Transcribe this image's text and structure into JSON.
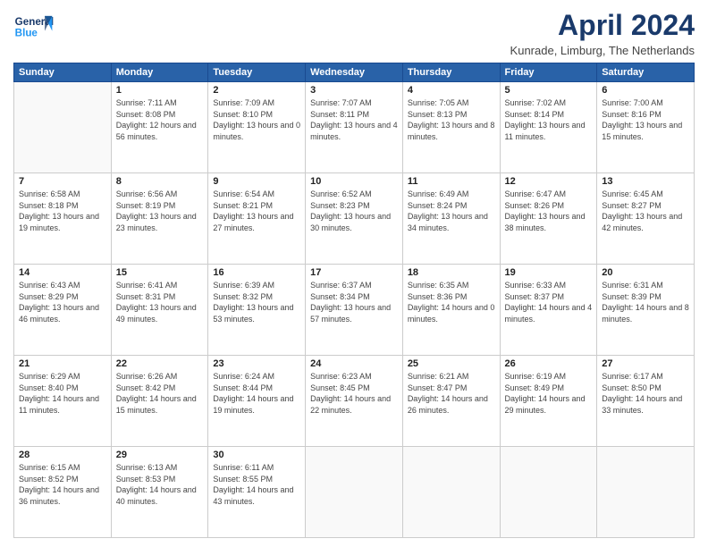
{
  "header": {
    "logo_line1": "General",
    "logo_line2": "Blue",
    "month_title": "April 2024",
    "location": "Kunrade, Limburg, The Netherlands"
  },
  "weekdays": [
    "Sunday",
    "Monday",
    "Tuesday",
    "Wednesday",
    "Thursday",
    "Friday",
    "Saturday"
  ],
  "weeks": [
    [
      {
        "day": "",
        "sunrise": "",
        "sunset": "",
        "daylight": ""
      },
      {
        "day": "1",
        "sunrise": "Sunrise: 7:11 AM",
        "sunset": "Sunset: 8:08 PM",
        "daylight": "Daylight: 12 hours and 56 minutes."
      },
      {
        "day": "2",
        "sunrise": "Sunrise: 7:09 AM",
        "sunset": "Sunset: 8:10 PM",
        "daylight": "Daylight: 13 hours and 0 minutes."
      },
      {
        "day": "3",
        "sunrise": "Sunrise: 7:07 AM",
        "sunset": "Sunset: 8:11 PM",
        "daylight": "Daylight: 13 hours and 4 minutes."
      },
      {
        "day": "4",
        "sunrise": "Sunrise: 7:05 AM",
        "sunset": "Sunset: 8:13 PM",
        "daylight": "Daylight: 13 hours and 8 minutes."
      },
      {
        "day": "5",
        "sunrise": "Sunrise: 7:02 AM",
        "sunset": "Sunset: 8:14 PM",
        "daylight": "Daylight: 13 hours and 11 minutes."
      },
      {
        "day": "6",
        "sunrise": "Sunrise: 7:00 AM",
        "sunset": "Sunset: 8:16 PM",
        "daylight": "Daylight: 13 hours and 15 minutes."
      }
    ],
    [
      {
        "day": "7",
        "sunrise": "Sunrise: 6:58 AM",
        "sunset": "Sunset: 8:18 PM",
        "daylight": "Daylight: 13 hours and 19 minutes."
      },
      {
        "day": "8",
        "sunrise": "Sunrise: 6:56 AM",
        "sunset": "Sunset: 8:19 PM",
        "daylight": "Daylight: 13 hours and 23 minutes."
      },
      {
        "day": "9",
        "sunrise": "Sunrise: 6:54 AM",
        "sunset": "Sunset: 8:21 PM",
        "daylight": "Daylight: 13 hours and 27 minutes."
      },
      {
        "day": "10",
        "sunrise": "Sunrise: 6:52 AM",
        "sunset": "Sunset: 8:23 PM",
        "daylight": "Daylight: 13 hours and 30 minutes."
      },
      {
        "day": "11",
        "sunrise": "Sunrise: 6:49 AM",
        "sunset": "Sunset: 8:24 PM",
        "daylight": "Daylight: 13 hours and 34 minutes."
      },
      {
        "day": "12",
        "sunrise": "Sunrise: 6:47 AM",
        "sunset": "Sunset: 8:26 PM",
        "daylight": "Daylight: 13 hours and 38 minutes."
      },
      {
        "day": "13",
        "sunrise": "Sunrise: 6:45 AM",
        "sunset": "Sunset: 8:27 PM",
        "daylight": "Daylight: 13 hours and 42 minutes."
      }
    ],
    [
      {
        "day": "14",
        "sunrise": "Sunrise: 6:43 AM",
        "sunset": "Sunset: 8:29 PM",
        "daylight": "Daylight: 13 hours and 46 minutes."
      },
      {
        "day": "15",
        "sunrise": "Sunrise: 6:41 AM",
        "sunset": "Sunset: 8:31 PM",
        "daylight": "Daylight: 13 hours and 49 minutes."
      },
      {
        "day": "16",
        "sunrise": "Sunrise: 6:39 AM",
        "sunset": "Sunset: 8:32 PM",
        "daylight": "Daylight: 13 hours and 53 minutes."
      },
      {
        "day": "17",
        "sunrise": "Sunrise: 6:37 AM",
        "sunset": "Sunset: 8:34 PM",
        "daylight": "Daylight: 13 hours and 57 minutes."
      },
      {
        "day": "18",
        "sunrise": "Sunrise: 6:35 AM",
        "sunset": "Sunset: 8:36 PM",
        "daylight": "Daylight: 14 hours and 0 minutes."
      },
      {
        "day": "19",
        "sunrise": "Sunrise: 6:33 AM",
        "sunset": "Sunset: 8:37 PM",
        "daylight": "Daylight: 14 hours and 4 minutes."
      },
      {
        "day": "20",
        "sunrise": "Sunrise: 6:31 AM",
        "sunset": "Sunset: 8:39 PM",
        "daylight": "Daylight: 14 hours and 8 minutes."
      }
    ],
    [
      {
        "day": "21",
        "sunrise": "Sunrise: 6:29 AM",
        "sunset": "Sunset: 8:40 PM",
        "daylight": "Daylight: 14 hours and 11 minutes."
      },
      {
        "day": "22",
        "sunrise": "Sunrise: 6:26 AM",
        "sunset": "Sunset: 8:42 PM",
        "daylight": "Daylight: 14 hours and 15 minutes."
      },
      {
        "day": "23",
        "sunrise": "Sunrise: 6:24 AM",
        "sunset": "Sunset: 8:44 PM",
        "daylight": "Daylight: 14 hours and 19 minutes."
      },
      {
        "day": "24",
        "sunrise": "Sunrise: 6:23 AM",
        "sunset": "Sunset: 8:45 PM",
        "daylight": "Daylight: 14 hours and 22 minutes."
      },
      {
        "day": "25",
        "sunrise": "Sunrise: 6:21 AM",
        "sunset": "Sunset: 8:47 PM",
        "daylight": "Daylight: 14 hours and 26 minutes."
      },
      {
        "day": "26",
        "sunrise": "Sunrise: 6:19 AM",
        "sunset": "Sunset: 8:49 PM",
        "daylight": "Daylight: 14 hours and 29 minutes."
      },
      {
        "day": "27",
        "sunrise": "Sunrise: 6:17 AM",
        "sunset": "Sunset: 8:50 PM",
        "daylight": "Daylight: 14 hours and 33 minutes."
      }
    ],
    [
      {
        "day": "28",
        "sunrise": "Sunrise: 6:15 AM",
        "sunset": "Sunset: 8:52 PM",
        "daylight": "Daylight: 14 hours and 36 minutes."
      },
      {
        "day": "29",
        "sunrise": "Sunrise: 6:13 AM",
        "sunset": "Sunset: 8:53 PM",
        "daylight": "Daylight: 14 hours and 40 minutes."
      },
      {
        "day": "30",
        "sunrise": "Sunrise: 6:11 AM",
        "sunset": "Sunset: 8:55 PM",
        "daylight": "Daylight: 14 hours and 43 minutes."
      },
      {
        "day": "",
        "sunrise": "",
        "sunset": "",
        "daylight": ""
      },
      {
        "day": "",
        "sunrise": "",
        "sunset": "",
        "daylight": ""
      },
      {
        "day": "",
        "sunrise": "",
        "sunset": "",
        "daylight": ""
      },
      {
        "day": "",
        "sunrise": "",
        "sunset": "",
        "daylight": ""
      }
    ]
  ]
}
